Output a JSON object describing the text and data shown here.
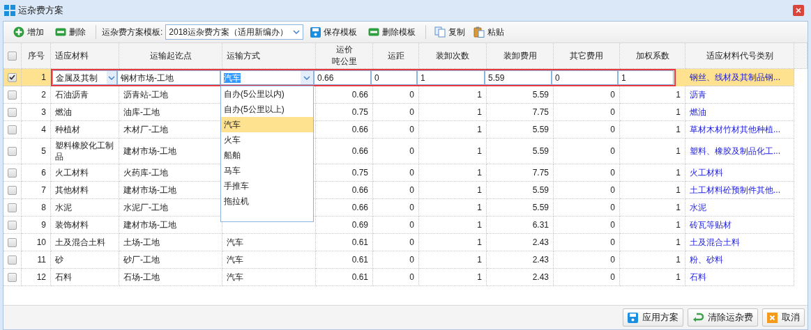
{
  "window": {
    "title": "运杂费方案"
  },
  "toolbar": {
    "buttons": [
      {
        "kind": "add",
        "label": "增加"
      },
      {
        "kind": "remove",
        "label": "删除"
      }
    ],
    "template_label": "运杂费方案模板:",
    "template_value": "2018运杂费方案（适用新编办）",
    "template_buttons": [
      {
        "kind": "save",
        "label": "保存模板"
      },
      {
        "kind": "remove",
        "label": "删除模板"
      }
    ],
    "edit_buttons": [
      {
        "kind": "copy",
        "label": "复制"
      },
      {
        "kind": "paste",
        "label": "粘贴"
      }
    ]
  },
  "table": {
    "header_checked": false,
    "columns": [
      "序号",
      "适应材料",
      "运输起讫点",
      "运输方式",
      [
        "运价",
        "吨公里"
      ],
      "运距",
      "装卸次数",
      "装卸费用",
      "其它费用",
      "加权系数",
      "适应材料代号类别"
    ],
    "rows": [
      {
        "checked": true,
        "selected": true,
        "editing": true,
        "no": "1",
        "material": "金属及其制",
        "route": "钢材市场-工地",
        "transport": "汽车",
        "price": "0.66",
        "distance": "0",
        "loads": "1",
        "load_fee": "5.59",
        "other_fee": "0",
        "weight": "1",
        "category": "钢丝、线材及其制品钢..."
      },
      {
        "checked": false,
        "selected": false,
        "editing": false,
        "no": "2",
        "material": "石油沥青",
        "route": "沥青站-工地",
        "price": "0.66",
        "distance": "0",
        "loads": "1",
        "load_fee": "5.59",
        "other_fee": "0",
        "weight": "1",
        "category": "沥青"
      },
      {
        "checked": false,
        "selected": false,
        "editing": false,
        "no": "3",
        "material": "燃油",
        "route": "油库-工地",
        "price": "0.75",
        "distance": "0",
        "loads": "1",
        "load_fee": "7.75",
        "other_fee": "0",
        "weight": "1",
        "category": "燃油"
      },
      {
        "checked": false,
        "selected": false,
        "editing": false,
        "no": "4",
        "material": "种植材",
        "route": "木材厂-工地",
        "price": "0.66",
        "distance": "0",
        "loads": "1",
        "load_fee": "5.59",
        "other_fee": "0",
        "weight": "1",
        "category": "草材木材竹材其他种植..."
      },
      {
        "checked": false,
        "selected": false,
        "editing": false,
        "no": "5",
        "material": "塑料橡胶化工制品",
        "route": "建材市场-工地",
        "price": "0.66",
        "distance": "0",
        "loads": "1",
        "load_fee": "5.59",
        "other_fee": "0",
        "weight": "1",
        "category": "塑料、橡胶及制品化工..."
      },
      {
        "checked": false,
        "selected": false,
        "editing": false,
        "no": "6",
        "material": "火工材料",
        "route": "火药库-工地",
        "price": "0.75",
        "distance": "0",
        "loads": "1",
        "load_fee": "7.75",
        "other_fee": "0",
        "weight": "1",
        "category": "火工材料"
      },
      {
        "checked": false,
        "selected": false,
        "editing": false,
        "no": "7",
        "material": "其他材料",
        "route": "建材市场-工地",
        "price": "0.66",
        "distance": "0",
        "loads": "1",
        "load_fee": "5.59",
        "other_fee": "0",
        "weight": "1",
        "category": "土工材料砼预制件其他..."
      },
      {
        "checked": false,
        "selected": false,
        "editing": false,
        "no": "8",
        "material": "水泥",
        "route": "水泥厂-工地",
        "price": "0.66",
        "distance": "0",
        "loads": "1",
        "load_fee": "5.59",
        "other_fee": "0",
        "weight": "1",
        "category": "水泥"
      },
      {
        "checked": false,
        "selected": false,
        "editing": false,
        "no": "9",
        "material": "装饰材料",
        "route": "建材市场-工地",
        "price": "0.69",
        "distance": "0",
        "loads": "1",
        "load_fee": "6.31",
        "other_fee": "0",
        "weight": "1",
        "category": "砖瓦等贴材"
      },
      {
        "checked": false,
        "selected": false,
        "editing": false,
        "no": "10",
        "material": "土及混合土料",
        "route": "土场-工地",
        "transport": "汽车",
        "price": "0.61",
        "distance": "0",
        "loads": "1",
        "load_fee": "2.43",
        "other_fee": "0",
        "weight": "1",
        "category": "土及混合土料"
      },
      {
        "checked": false,
        "selected": false,
        "editing": false,
        "no": "11",
        "material": "砂",
        "route": "砂厂-工地",
        "transport": "汽车",
        "price": "0.61",
        "distance": "0",
        "loads": "1",
        "load_fee": "2.43",
        "other_fee": "0",
        "weight": "1",
        "category": "粉、砂料"
      },
      {
        "checked": false,
        "selected": false,
        "editing": false,
        "no": "12",
        "material": "石料",
        "route": "石场-工地",
        "transport": "汽车",
        "price": "0.61",
        "distance": "0",
        "loads": "1",
        "load_fee": "2.43",
        "other_fee": "0",
        "weight": "1",
        "category": "石料"
      }
    ]
  },
  "dropdown": {
    "options": [
      {
        "label": "自办(5公里以内)",
        "selected": false
      },
      {
        "label": "自办(5公里以上)",
        "selected": false
      },
      {
        "label": "汽车",
        "selected": true
      },
      {
        "label": "火车",
        "selected": false
      },
      {
        "label": "船舶",
        "selected": false
      },
      {
        "label": "马车",
        "selected": false
      },
      {
        "label": "手推车",
        "selected": false
      },
      {
        "label": "拖拉机",
        "selected": false
      }
    ]
  },
  "footer": {
    "buttons": [
      {
        "kind": "save",
        "label": "应用方案"
      },
      {
        "kind": "clear",
        "label": "清除运杂费"
      },
      {
        "kind": "cancel",
        "label": "取消"
      }
    ]
  }
}
